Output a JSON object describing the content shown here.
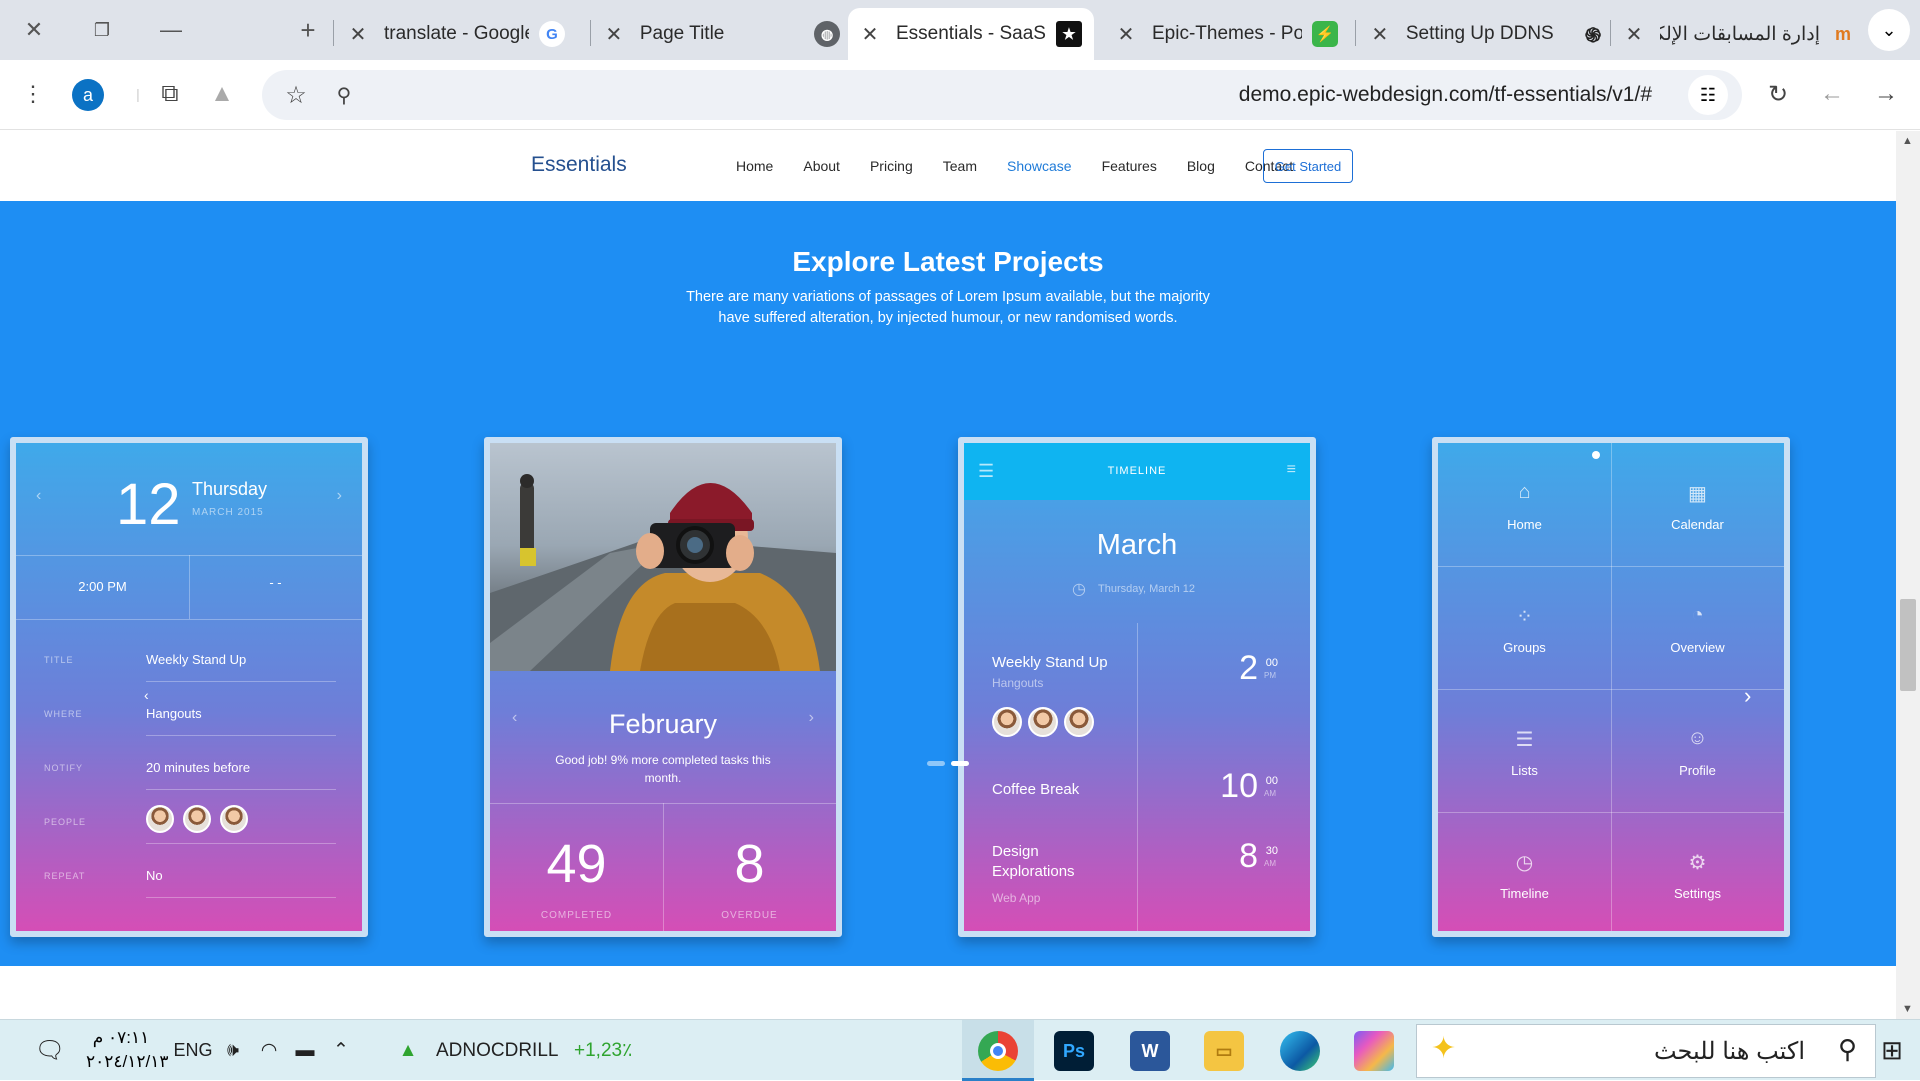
{
  "browser": {
    "tabs": [
      {
        "title": "translate - Google",
        "favicon": "G"
      },
      {
        "title": "Page Title",
        "favicon": "globe"
      },
      {
        "title": "Essentials - SaaS La",
        "favicon": "★",
        "active": true
      },
      {
        "title": "Epic-Themes - Port",
        "favicon": "⚡"
      },
      {
        "title": "Setting Up DDNS",
        "favicon": "◎"
      },
      {
        "title": "إدارة المسابقات الإلكت",
        "favicon": "m"
      }
    ],
    "profile_initial": "a",
    "url": "demo.epic-webdesign.com/tf-essentials/v1/#"
  },
  "site": {
    "logo": "Essentials",
    "nav": [
      "Home",
      "About",
      "Pricing",
      "Team",
      "Showcase",
      "Features",
      "Blog",
      "Contact"
    ],
    "active_nav": "Showcase",
    "cta": "Get Started",
    "section": {
      "title": "Explore Latest Projects",
      "subtitle_line1": "There are many variations of passages of Lorem Ipsum available, but the majority",
      "subtitle_line2": "have suffered alteration, by injected humour, or new randomised words."
    }
  },
  "cards": {
    "event": {
      "day": "12",
      "weekday": "Thursday",
      "month": "MARCH 2015",
      "time": "2:00 PM",
      "end_time": "- -",
      "rows": [
        {
          "label": "TITLE",
          "value": "Weekly Stand Up"
        },
        {
          "label": "WHERE",
          "value": "Hangouts"
        },
        {
          "label": "NOTIFY",
          "value": "20 minutes before"
        },
        {
          "label": "PEOPLE",
          "value": ""
        },
        {
          "label": "REPEAT",
          "value": "No"
        }
      ]
    },
    "stats": {
      "month": "February",
      "note": "Good job! 9% more completed tasks this month.",
      "completed": "49",
      "completed_label": "COMPLETED",
      "overdue": "8",
      "overdue_label": "OVERDUE"
    },
    "timeline": {
      "header": "TIMELINE",
      "month": "March",
      "date": "Thursday, March 12",
      "events": [
        {
          "title": "Weekly Stand Up",
          "sub": "Hangouts",
          "hour": "2",
          "min": "00",
          "ampm": "PM"
        },
        {
          "title": "Coffee Break",
          "sub": "",
          "hour": "10",
          "min": "00",
          "ampm": "AM"
        },
        {
          "title": "Design",
          "title2": "Explorations",
          "sub": "Web App",
          "hour": "8",
          "min": "30",
          "ampm": "AM"
        }
      ]
    },
    "menu": {
      "tiles": [
        "Home",
        "Calendar",
        "Groups",
        "Overview",
        "Lists",
        "Profile",
        "Timeline",
        "Settings"
      ]
    }
  },
  "taskbar": {
    "time": "٠٧:١١ م",
    "date": "٢٠٢٤/١٢/١٣",
    "lang": "ENG",
    "stock_name": "ADNOCDRILL",
    "stock_change": "+1,23٪",
    "search_placeholder": "اكتب هنا للبحث"
  }
}
